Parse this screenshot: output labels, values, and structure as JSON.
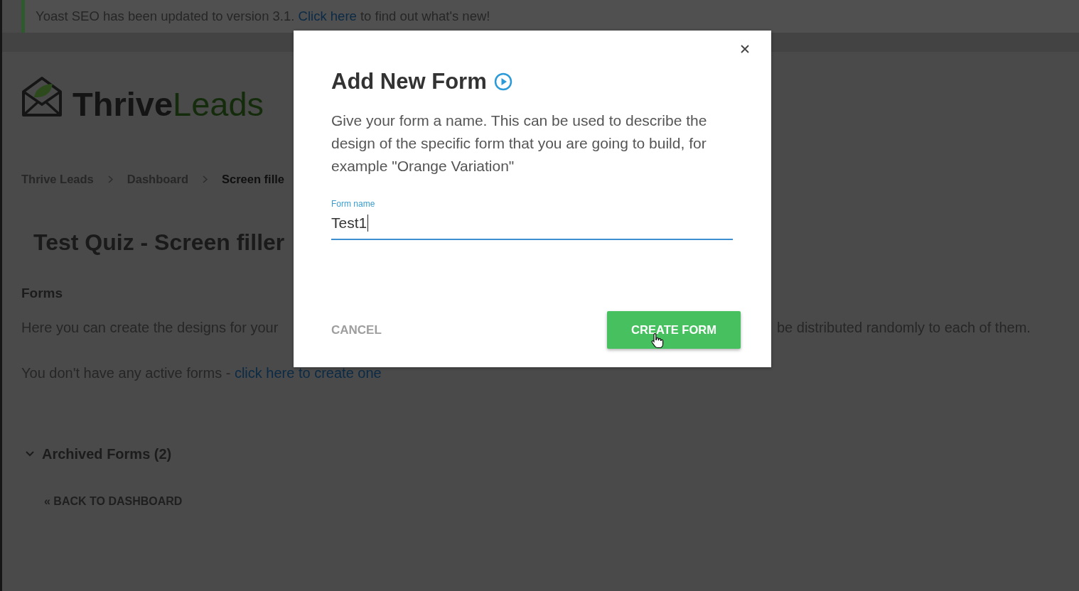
{
  "notice": {
    "text_before": "Yoast SEO has been updated to version 3.1. ",
    "link": "Click here",
    "text_after": " to find out what's new!"
  },
  "logo": {
    "bold_part": "Thrive",
    "light_part": "Leads"
  },
  "breadcrumb": [
    {
      "label": "Thrive Leads",
      "current": false
    },
    {
      "label": "Dashboard",
      "current": false
    },
    {
      "label": "Screen fille",
      "current": true
    }
  ],
  "page_title": "Test Quiz - Screen filler",
  "forms_section": {
    "heading": "Forms",
    "intro_left": "Here you can create the designs for your",
    "intro_right": "be distributed randomly to each of them.",
    "empty_text": "You don't have any active forms - ",
    "empty_link": "click here to create one"
  },
  "archived": {
    "label": "Archived Forms (2)"
  },
  "back_link": "« BACK TO DASHBOARD",
  "modal": {
    "title": "Add New Form",
    "description": "Give your form a name. This can be used to describe the design of the specific form that you are going to build, for example \"Orange Variation\"",
    "field": {
      "label": "Form name",
      "value": "Test1",
      "focused": true
    },
    "buttons": [
      {
        "label": "CANCEL",
        "kind": "flat"
      },
      {
        "label": "CREATE FORM",
        "kind": "raised"
      }
    ]
  }
}
